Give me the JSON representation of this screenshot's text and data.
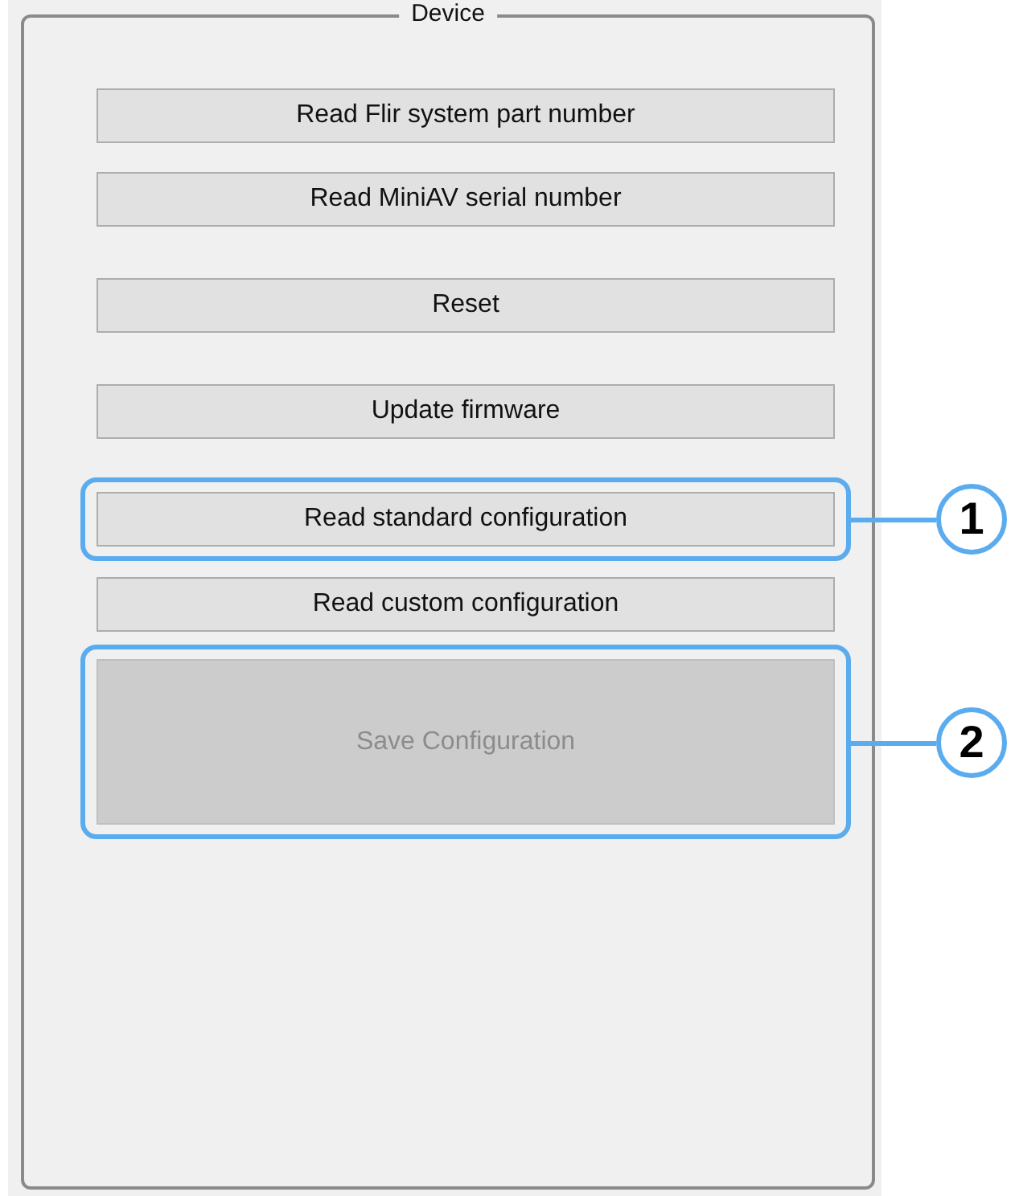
{
  "group_box": {
    "title": "Device"
  },
  "buttons": [
    {
      "label": "Read Flir system part number",
      "disabled": false
    },
    {
      "label": "Read MiniAV serial number",
      "disabled": false
    },
    {
      "label": "Reset",
      "disabled": false
    },
    {
      "label": "Update firmware",
      "disabled": false
    },
    {
      "label": "Read standard configuration",
      "disabled": false,
      "callout": "1"
    },
    {
      "label": "Read custom configuration",
      "disabled": false
    },
    {
      "label": "Save Configuration",
      "disabled": true,
      "callout": "2"
    }
  ]
}
